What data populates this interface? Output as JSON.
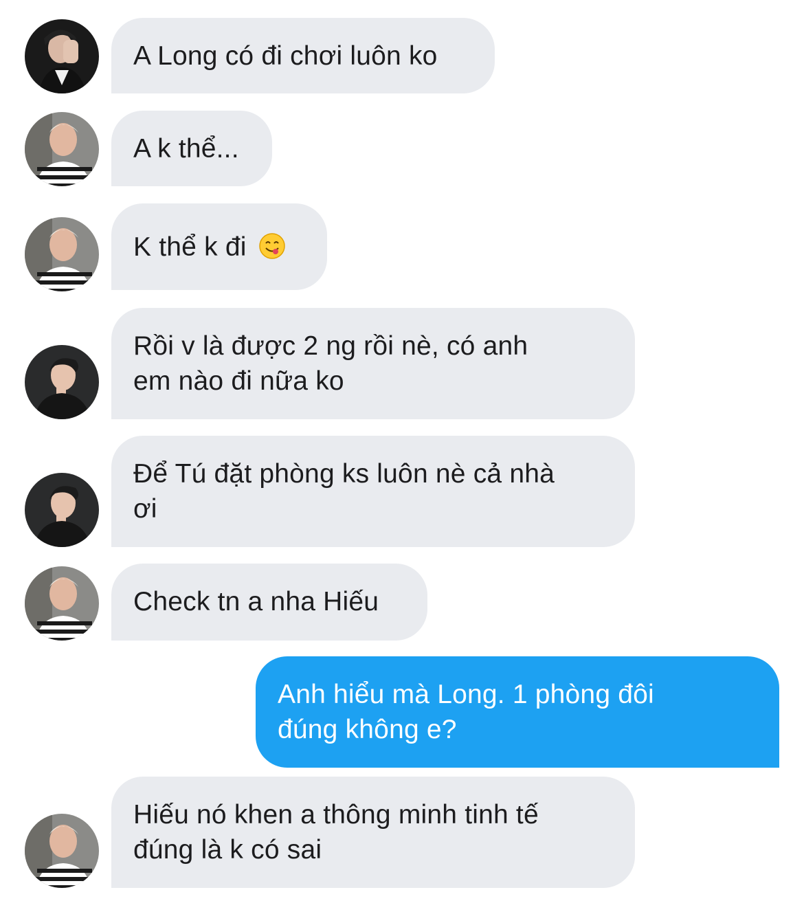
{
  "messages": [
    {
      "sender": "avatar-1",
      "lines": [
        "A Long có đi chơi luôn ko"
      ]
    },
    {
      "sender": "avatar-2",
      "lines": [
        "A k thể..."
      ]
    },
    {
      "sender": "avatar-2",
      "lines": [
        "K thể k đi"
      ],
      "emoji": "face-savoring-food-emoji"
    },
    {
      "sender": "avatar-3",
      "lines": [
        "Rồi v là được 2 ng rồi nè, có anh",
        "em nào đi nữa ko"
      ]
    },
    {
      "sender": "avatar-3",
      "lines": [
        "Để Tú đặt phòng ks luôn nè cả nhà",
        "ơi"
      ]
    },
    {
      "sender": "avatar-2",
      "lines": [
        "Check tn a nha Hiếu"
      ]
    },
    {
      "sender": "me",
      "lines": [
        "Anh hiểu mà Long. 1 phòng đôi",
        "đúng không e?"
      ]
    },
    {
      "sender": "avatar-2",
      "lines": [
        "Hiếu nó khen a thông minh tinh tế",
        "đúng là k có sai"
      ]
    }
  ],
  "colors": {
    "incoming_bubble": "#e9ebef",
    "outgoing_bubble": "#1da1f2",
    "incoming_text": "#1c1c1e",
    "outgoing_text": "#ffffff"
  }
}
